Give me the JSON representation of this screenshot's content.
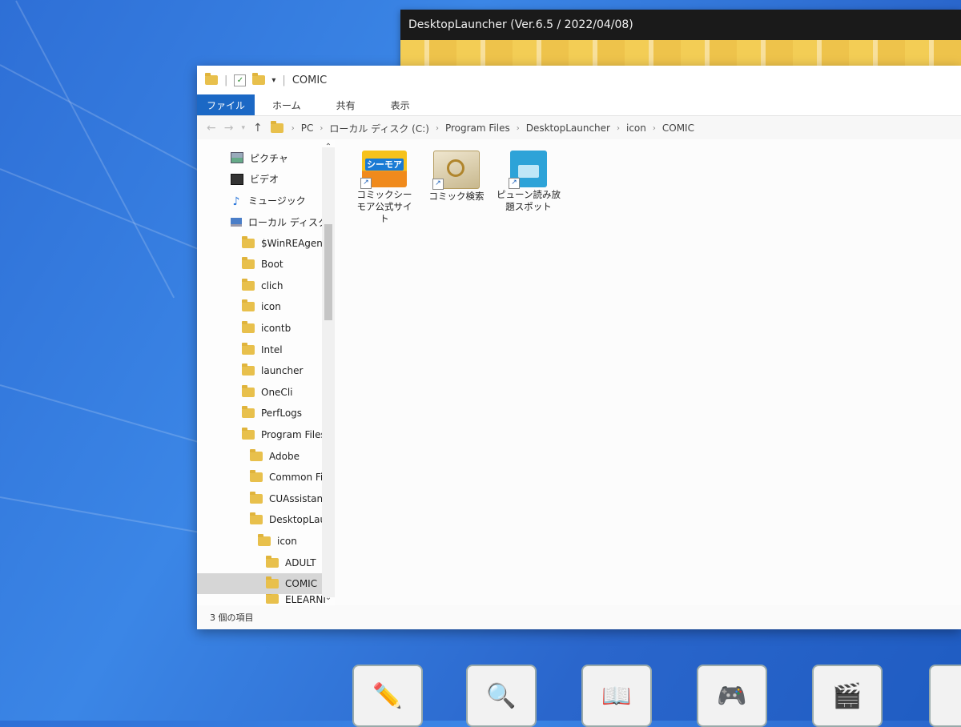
{
  "launcher": {
    "title": "DesktopLauncher (Ver.6.5 / 2022/04/08)"
  },
  "explorer": {
    "title": "COMIC",
    "ribbon_tabs": [
      "ファイル",
      "ホーム",
      "共有",
      "表示"
    ],
    "breadcrumb": [
      "PC",
      "ローカル ディスク (C:)",
      "Program Files",
      "DesktopLauncher",
      "icon",
      "COMIC"
    ],
    "nav_items": [
      {
        "label": "ピクチャ",
        "icon": "pictures-icon",
        "indent": 0
      },
      {
        "label": "ビデオ",
        "icon": "videos-icon",
        "indent": 0
      },
      {
        "label": "ミュージック",
        "icon": "music-icon",
        "indent": 0
      },
      {
        "label": "ローカル ディスク (",
        "icon": "drive-icon",
        "indent": 0
      },
      {
        "label": "$WinREAgent",
        "icon": "folder-icon",
        "indent": 1
      },
      {
        "label": "Boot",
        "icon": "folder-icon",
        "indent": 1
      },
      {
        "label": "clich",
        "icon": "folder-icon",
        "indent": 1
      },
      {
        "label": "icon",
        "icon": "folder-icon",
        "indent": 1
      },
      {
        "label": "icontb",
        "icon": "folder-icon",
        "indent": 1
      },
      {
        "label": "Intel",
        "icon": "folder-icon",
        "indent": 1
      },
      {
        "label": "launcher",
        "icon": "folder-icon",
        "indent": 1
      },
      {
        "label": "OneCli",
        "icon": "folder-icon",
        "indent": 1
      },
      {
        "label": "PerfLogs",
        "icon": "folder-icon",
        "indent": 1
      },
      {
        "label": "Program Files",
        "icon": "folder-icon",
        "indent": 1
      },
      {
        "label": "Adobe",
        "icon": "folder-icon",
        "indent": 2
      },
      {
        "label": "Common Fil",
        "icon": "folder-icon",
        "indent": 2
      },
      {
        "label": "CUAssistant",
        "icon": "folder-icon",
        "indent": 2
      },
      {
        "label": "DesktopLau",
        "icon": "folder-icon",
        "indent": 2
      },
      {
        "label": "icon",
        "icon": "folder-icon",
        "indent": 3
      },
      {
        "label": "ADULT",
        "icon": "folder-icon",
        "indent": 4
      },
      {
        "label": "COMIC",
        "icon": "folder-icon",
        "indent": 4,
        "selected": true
      },
      {
        "label": "ELEARNI",
        "icon": "folder-icon",
        "indent": 4
      }
    ],
    "files": [
      {
        "label": "コミックシーモア公式サイト",
        "icon": "cmoa-app-icon",
        "badge": "シーモア"
      },
      {
        "label": "コミック検索",
        "icon": "comic-search-icon"
      },
      {
        "label": "ピューン読み放題スポット",
        "icon": "pyun-yomi-icon"
      }
    ],
    "status": "3 個の項目"
  }
}
